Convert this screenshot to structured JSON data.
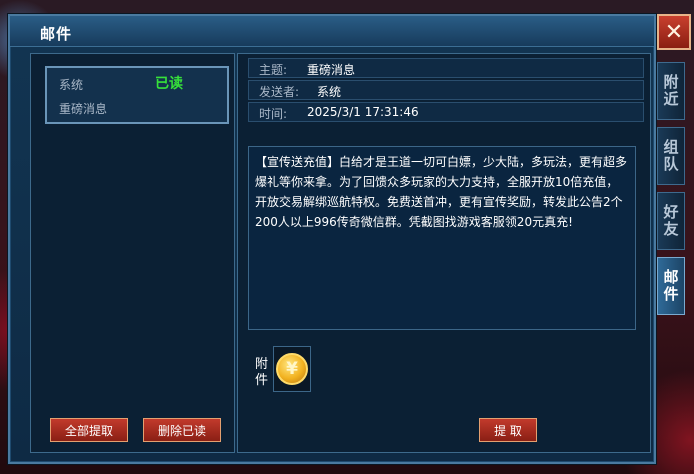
{
  "window": {
    "title": "邮件",
    "close_label": "✕"
  },
  "side_tabs": [
    {
      "label": "附近",
      "active": false
    },
    {
      "label": "组队",
      "active": false
    },
    {
      "label": "好友",
      "active": false
    },
    {
      "label": "邮件",
      "active": true
    }
  ],
  "mail_list": [
    {
      "sender": "系统",
      "status": "已读",
      "subject": "重磅消息"
    }
  ],
  "left_buttons": {
    "collect_all": "全部提取",
    "delete_read": "删除已读"
  },
  "detail": {
    "subject_label": "主题:",
    "subject_value": "重磅消息",
    "sender_label": "发送者:",
    "sender_value": "系统",
    "time_label": "时间:",
    "time_value": "2025/3/1 17:31:46",
    "body": "【宣传送充值】白给才是王道一切可白嫖，少大陆，多玩法，更有超多爆礼等你来拿。为了回馈众多玩家的大力支持，全服开放10倍充值，开放交易解绑巡航特权。免费送首冲，更有宣传奖励，转发此公告2个200人以上996传奇微信群。凭截图找游戏客服领20元真充!",
    "attachment_label": "附件",
    "attachment_icon": "gold-coin-icon",
    "collect_label": "提 取"
  },
  "colors": {
    "read_status": "#36e03a",
    "button_red": "#c23a2c",
    "panel_bg": "#0b2034"
  }
}
